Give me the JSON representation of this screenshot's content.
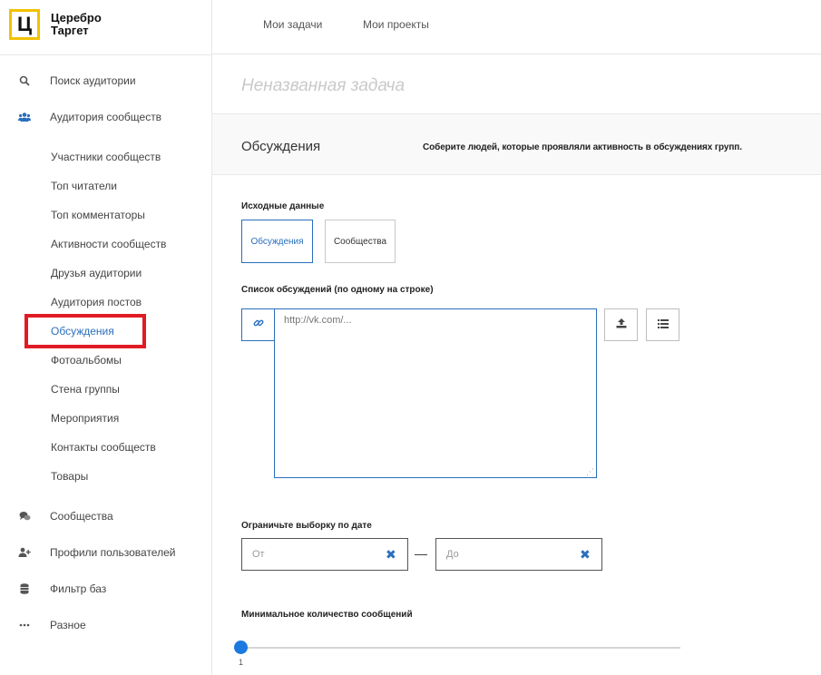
{
  "logo": {
    "mark": "Ц",
    "line1": "Церебро",
    "line2": "Таргет"
  },
  "topbar": {
    "links": [
      "Мои задачи",
      "Мои проекты"
    ]
  },
  "sidebar": {
    "search": "Поиск аудитории",
    "communities_audience": "Аудитория сообществ",
    "sub_items": [
      "Участники сообществ",
      "Топ читатели",
      "Топ комментаторы",
      "Активности сообществ",
      "Друзья аудитории",
      "Аудитория постов",
      "Обсуждения",
      "Фотоальбомы",
      "Стена группы",
      "Мероприятия",
      "Контакты сообществ",
      "Товары"
    ],
    "active_sub": "Обсуждения",
    "communities": "Сообщества",
    "user_profiles": "Профили пользователей",
    "db_filter": "Фильтр баз",
    "misc": "Разное"
  },
  "task": {
    "title": "Неназванная задача"
  },
  "section": {
    "title": "Обсуждения",
    "description": "Соберите людей, которые проявляли активность в обсуждениях групп."
  },
  "source": {
    "label": "Исходные данные",
    "tabs": [
      "Обсуждения",
      "Сообщества"
    ],
    "active_tab": "Обсуждения"
  },
  "discussions_list": {
    "label": "Список обсуждений (по одному на строке)",
    "placeholder": "http://vk.com/..."
  },
  "date_limit": {
    "label": "Ограничьте выборку по дате",
    "from_placeholder": "От",
    "to_placeholder": "До",
    "separator": "—"
  },
  "min_messages": {
    "label": "Минимальное количество сообщений",
    "value": "1"
  },
  "colors": {
    "accent": "#2a6fbd",
    "logo_yellow": "#f2c200",
    "highlight": "#e01b24",
    "slider": "#1a7ae0"
  }
}
